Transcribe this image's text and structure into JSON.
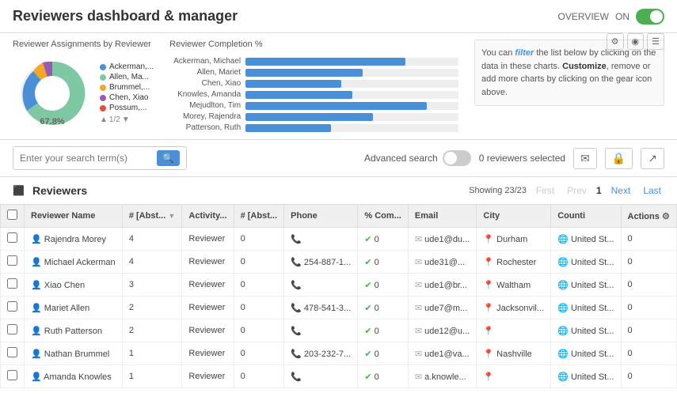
{
  "header": {
    "title": "Reviewers dashboard & manager",
    "overview_label": "OVERVIEW",
    "toggle_state": "ON"
  },
  "charts": {
    "pie_chart": {
      "title": "Reviewer Assignments by Reviewer",
      "center_label": "67.8%",
      "legend": [
        {
          "name": "Ackerman,...",
          "color": "#4a90d9"
        },
        {
          "name": "Allen, Ma...",
          "color": "#7ec8a4"
        },
        {
          "name": "Brummel,...",
          "color": "#f5a623"
        },
        {
          "name": "Chen, Xiao",
          "color": "#9b59b6"
        },
        {
          "name": "Possum,...",
          "color": "#e74c3c"
        }
      ],
      "pagination": "1/2"
    },
    "bar_chart": {
      "title": "Reviewer Completion %",
      "bars": [
        {
          "name": "Ackerman, Michael",
          "pct": 75
        },
        {
          "name": "Allen, Mariet",
          "pct": 55
        },
        {
          "name": "Chen, Xiao",
          "pct": 45
        },
        {
          "name": "Knowles, Amanda",
          "pct": 50
        },
        {
          "name": "Mejudlton, Tim",
          "pct": 85
        },
        {
          "name": "Morey, Rajendra",
          "pct": 60
        },
        {
          "name": "Patterson, Ruth",
          "pct": 40
        }
      ]
    },
    "info_text": "You can filter the list below by clicking on the data in these charts. Customize, remove or add more charts by clicking on the gear icon above."
  },
  "toolbar": {
    "search_placeholder": "Enter your search term(s)",
    "search_icon": "🔍",
    "advanced_search_label": "Advanced search",
    "toggle_label": "OFF",
    "selected_count": "0 reviewers selected",
    "email_icon": "✉",
    "lock_icon": "🔒",
    "share_icon": "↗"
  },
  "table": {
    "title": "Reviewers",
    "showing_label": "Showing 23/23",
    "nav": {
      "first": "First",
      "prev": "Prev",
      "page": "1",
      "next": "Next",
      "last": "Last"
    },
    "columns": [
      "",
      "Reviewer Name",
      "# [Abst...",
      "Activity...",
      "# [Abst...",
      "Phone",
      "% Com...",
      "Email",
      "City",
      "Counti",
      "Actions"
    ],
    "rows": [
      {
        "name": "Rajendra Morey",
        "abst1": "4",
        "activity": "Reviewer",
        "abst2": "0",
        "phone": "",
        "pct_complete": "✔ 0",
        "email": "ude1@du...",
        "city": "Durham",
        "country": "United St...",
        "actions": "0"
      },
      {
        "name": "Michael Ackerman",
        "abst1": "4",
        "activity": "Reviewer",
        "abst2": "0",
        "phone": "254-887-1...",
        "pct_complete": "✔ 0",
        "email": "ude31@...",
        "city": "Rochester",
        "country": "United St...",
        "actions": "0"
      },
      {
        "name": "Xiao Chen",
        "abst1": "3",
        "activity": "Reviewer",
        "abst2": "0",
        "phone": "",
        "pct_complete": "✔ 0",
        "email": "ude1@br...",
        "city": "Waltham",
        "country": "United St...",
        "actions": "0"
      },
      {
        "name": "Mariet Allen",
        "abst1": "2",
        "activity": "Reviewer",
        "abst2": "0",
        "phone": "478-541-3...",
        "pct_complete": "✔ 0",
        "email": "ude7@m...",
        "city": "Jacksonvil...",
        "country": "United St...",
        "actions": "0"
      },
      {
        "name": "Ruth Patterson",
        "abst1": "2",
        "activity": "Reviewer",
        "abst2": "0",
        "phone": "",
        "pct_complete": "✔ 0",
        "email": "ude12@u...",
        "city": "",
        "country": "United St...",
        "actions": "0"
      },
      {
        "name": "Nathan Brummel",
        "abst1": "1",
        "activity": "Reviewer",
        "abst2": "0",
        "phone": "203-232-7...",
        "pct_complete": "✔ 0",
        "email": "ude1@va...",
        "city": "Nashville",
        "country": "United St...",
        "actions": "0"
      },
      {
        "name": "Amanda Knowles",
        "abst1": "1",
        "activity": "Reviewer",
        "abst2": "0",
        "phone": "",
        "pct_complete": "✔ 0",
        "email": "a.knowle...",
        "city": "",
        "country": "United St...",
        "actions": "0"
      }
    ]
  }
}
